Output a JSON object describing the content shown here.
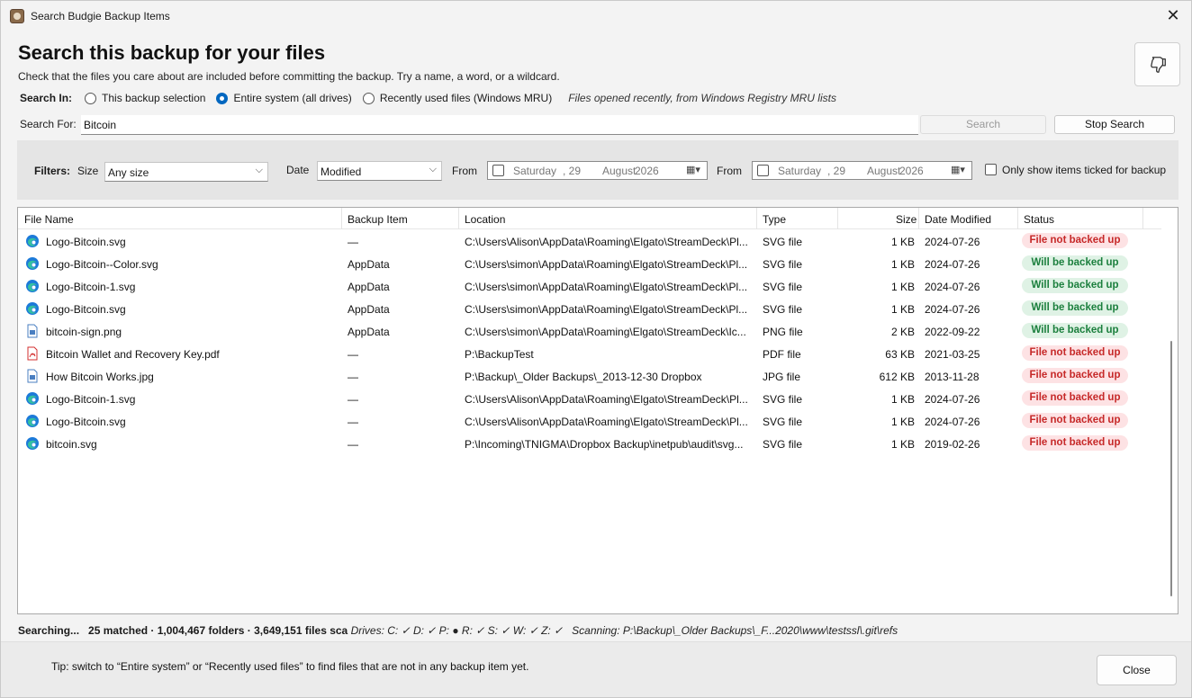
{
  "window": {
    "title": "Search Budgie Backup Items",
    "close_glyph": "✕"
  },
  "header": {
    "title": "Search this backup for your files",
    "subtitle": "Check that the files you care about are included before committing the backup. Try a name, a word, or a wildcard.",
    "feedback_icon": "thumbs-down-icon"
  },
  "search_in": {
    "label": "Search In:",
    "options": [
      {
        "label": "This backup selection",
        "selected": false
      },
      {
        "label": "Entire system (all drives)",
        "selected": true
      },
      {
        "label": "Recently used files (Windows MRU)",
        "selected": false
      }
    ],
    "hint": "Files opened recently, from Windows Registry MRU lists"
  },
  "search_for": {
    "label": "Search For:",
    "value": "Bitcoin",
    "search_button": "Search",
    "stop_button": "Stop Search"
  },
  "filters": {
    "label": "Filters:",
    "size_label": "Size",
    "size_value": "Any size",
    "date_label": "Date",
    "date_value": "Modified",
    "from1_label": "From",
    "from2_label": "From",
    "date1": {
      "day": "Saturday",
      "date": ", 29",
      "month": "August",
      "year": "2026"
    },
    "date2": {
      "day": "Saturday",
      "date": ", 29",
      "month": "August",
      "year": "2026"
    },
    "only_ticked_label": "Only show items ticked for backup"
  },
  "columns": [
    "File Name",
    "Backup Item",
    "Location",
    "Type",
    "Size",
    "Date Modified",
    "Status"
  ],
  "rows": [
    {
      "icon": "edge-svg-icon",
      "name": "Logo-Bitcoin.svg",
      "item": "—",
      "location": "C:\\Users\\Alison\\AppData\\Roaming\\Elgato\\StreamDeck\\Pl...",
      "type": "SVG file",
      "size": "1 KB",
      "date": "2024-07-26",
      "status": "File not backed up",
      "ok": false
    },
    {
      "icon": "edge-svg-icon",
      "name": "Logo-Bitcoin--Color.svg",
      "item": "AppData",
      "location": "C:\\Users\\simon\\AppData\\Roaming\\Elgato\\StreamDeck\\Pl...",
      "type": "SVG file",
      "size": "1 KB",
      "date": "2024-07-26",
      "status": "Will be backed up",
      "ok": true
    },
    {
      "icon": "edge-svg-icon",
      "name": "Logo-Bitcoin-1.svg",
      "item": "AppData",
      "location": "C:\\Users\\simon\\AppData\\Roaming\\Elgato\\StreamDeck\\Pl...",
      "type": "SVG file",
      "size": "1 KB",
      "date": "2024-07-26",
      "status": "Will be backed up",
      "ok": true
    },
    {
      "icon": "edge-svg-icon",
      "name": "Logo-Bitcoin.svg",
      "item": "AppData",
      "location": "C:\\Users\\simon\\AppData\\Roaming\\Elgato\\StreamDeck\\Pl...",
      "type": "SVG file",
      "size": "1 KB",
      "date": "2024-07-26",
      "status": "Will be backed up",
      "ok": true
    },
    {
      "icon": "image-file-icon",
      "name": "bitcoin-sign.png",
      "item": "AppData",
      "location": "C:\\Users\\simon\\AppData\\Roaming\\Elgato\\StreamDeck\\Ic...",
      "type": "PNG file",
      "size": "2 KB",
      "date": "2022-09-22",
      "status": "Will be backed up",
      "ok": true
    },
    {
      "icon": "pdf-file-icon",
      "name": "Bitcoin Wallet and Recovery Key.pdf",
      "item": "—",
      "location": "P:\\BackupTest",
      "type": "PDF file",
      "size": "63 KB",
      "date": "2021-03-25",
      "status": "File not backed up",
      "ok": false
    },
    {
      "icon": "image-file-icon",
      "name": "How Bitcoin Works.jpg",
      "item": "—",
      "location": "P:\\Backup\\_Older Backups\\_2013-12-30 Dropbox",
      "type": "JPG file",
      "size": "612 KB",
      "date": "2013-11-28",
      "status": "File not backed up",
      "ok": false
    },
    {
      "icon": "edge-svg-icon",
      "name": "Logo-Bitcoin-1.svg",
      "item": "—",
      "location": "C:\\Users\\Alison\\AppData\\Roaming\\Elgato\\StreamDeck\\Pl...",
      "type": "SVG file",
      "size": "1 KB",
      "date": "2024-07-26",
      "status": "File not backed up",
      "ok": false
    },
    {
      "icon": "edge-svg-icon",
      "name": "Logo-Bitcoin.svg",
      "item": "—",
      "location": "C:\\Users\\Alison\\AppData\\Roaming\\Elgato\\StreamDeck\\Pl...",
      "type": "SVG file",
      "size": "1 KB",
      "date": "2024-07-26",
      "status": "File not backed up",
      "ok": false
    },
    {
      "icon": "edge-svg-icon",
      "name": "bitcoin.svg",
      "item": "—",
      "location": "P:\\Incoming\\TNIGMA\\Dropbox Backup\\inetpub\\audit\\svg...",
      "type": "SVG file",
      "size": "1 KB",
      "date": "2019-02-26",
      "status": "File not backed up",
      "ok": false
    }
  ],
  "status_line": {
    "searching": "Searching...",
    "counts": "25 matched · 1,004,467 folders · 3,649,151 files sca",
    "drives": "Drives: C: ✓ D: ✓ P: ● R: ✓ S: ✓ W: ✓ Z: ✓",
    "scanning": "Scanning: P:\\Backup\\_Older Backups\\_F...2020\\www\\testssl\\.git\\refs"
  },
  "footer": {
    "tip": "Tip: switch to “Entire system” or “Recently used files” to find files that are not in any backup item yet.",
    "close_button": "Close"
  },
  "colors": {
    "accent": "#0067c0",
    "status_red": "#c62828",
    "status_green": "#1b7f3d"
  }
}
